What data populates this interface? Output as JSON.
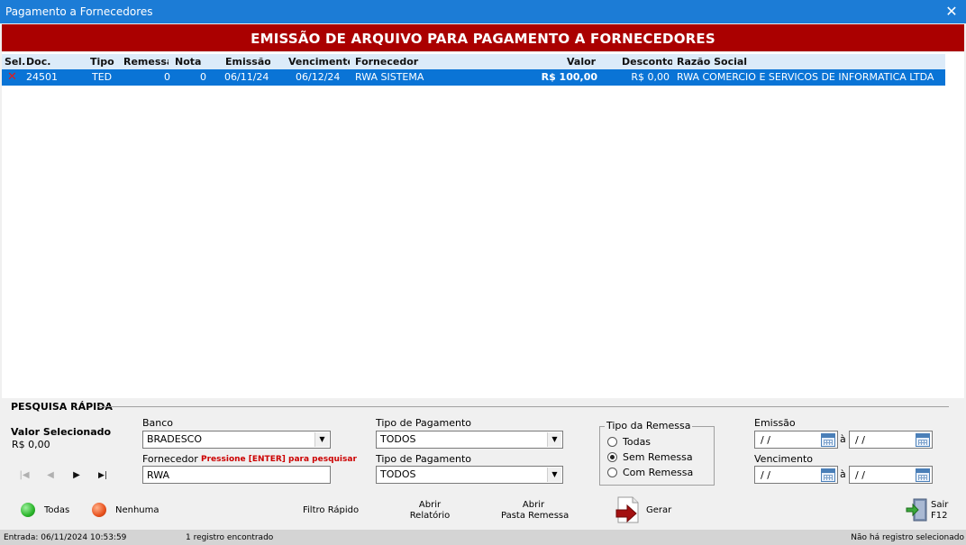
{
  "window": {
    "title": "Pagamento a Fornecedores",
    "close_glyph": "✕"
  },
  "banner": {
    "text": "EMISSÃO DE ARQUIVO PARA PAGAMENTO A FORNECEDORES",
    "color": "#aa0000"
  },
  "grid": {
    "columns": [
      "Sel.",
      "Doc.",
      "Tipo",
      "Remessa",
      "Nota",
      "Emissão",
      "Vencimento",
      "Fornecedor",
      "Valor",
      "Desconto",
      "Razão Social"
    ],
    "rows": [
      {
        "sel": "✕",
        "doc": "24501",
        "tipo": "TED",
        "remessa": "0",
        "nota": "0",
        "emissao": "06/11/24",
        "vencimento": "06/12/24",
        "fornecedor": "RWA SISTEMA",
        "valor": "R$ 100,00",
        "desconto": "R$ 0,00",
        "razao_social": "RWA COMERCIO E SERVICOS DE INFORMATICA LTDA"
      }
    ],
    "selected_row_color": "#0a74d6"
  },
  "search": {
    "section_title": "PESQUISA RÁPIDA",
    "valor_selecionado_label": "Valor Selecionado",
    "valor_selecionado": "R$ 0,00",
    "banco_label": "Banco",
    "banco_value": "BRADESCO",
    "fornecedor_label": "Fornecedor",
    "fornecedor_hint": "Pressione [ENTER] para pesquisar",
    "fornecedor_value": "RWA",
    "tipo_pagamento_label_1": "Tipo de Pagamento",
    "tipo_pagamento_value_1": "TODOS",
    "tipo_pagamento_label_2": "Tipo de Pagamento",
    "tipo_pagamento_value_2": "TODOS",
    "tipo_remessa_label": "Tipo da Remessa",
    "tipo_remessa_options": [
      "Todas",
      "Sem Remessa",
      "Com Remessa"
    ],
    "tipo_remessa_selected": "Sem Remessa",
    "emissao_label": "Emissão",
    "vencimento_label": "Vencimento",
    "date_empty": "/ /",
    "range_sep": "à"
  },
  "navigator": {
    "first": "|◀",
    "prev": "◀",
    "next": "▶",
    "last": "▶|"
  },
  "actions": {
    "todas": "Todas",
    "nenhuma": "Nenhuma",
    "filtro_rapido": "Filtro Rápido",
    "abrir_relatorio_1": "Abrir",
    "abrir_relatorio_2": "Relatório",
    "abrir_pasta_1": "Abrir",
    "abrir_pasta_2": "Pasta Remessa",
    "gerar": "Gerar",
    "sair_1": "Sair",
    "sair_2": "F12",
    "todas_color": "#2bb52b",
    "nenhuma_color": "#e8521e"
  },
  "statusbar": {
    "entrada": "Entrada: 06/11/2024 10:53:59",
    "registros": "1 registro encontrado",
    "selecao": "Não há registro selecionado"
  }
}
